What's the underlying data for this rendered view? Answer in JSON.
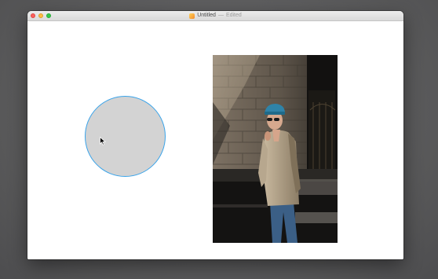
{
  "window": {
    "title": "Untitled",
    "separator": "—",
    "status": "Edited"
  },
  "canvas": {
    "circle": {
      "fill": "#d3d3d3",
      "stroke": "#3aa4ea"
    }
  },
  "colors": {
    "desktop": "#5f5f61",
    "window_bg": "#ffffff",
    "selection_accent": "#3aa4ea"
  },
  "icons": [
    "close-icon",
    "minimize-icon",
    "zoom-icon",
    "document-icon",
    "pointer-cursor-icon"
  ]
}
